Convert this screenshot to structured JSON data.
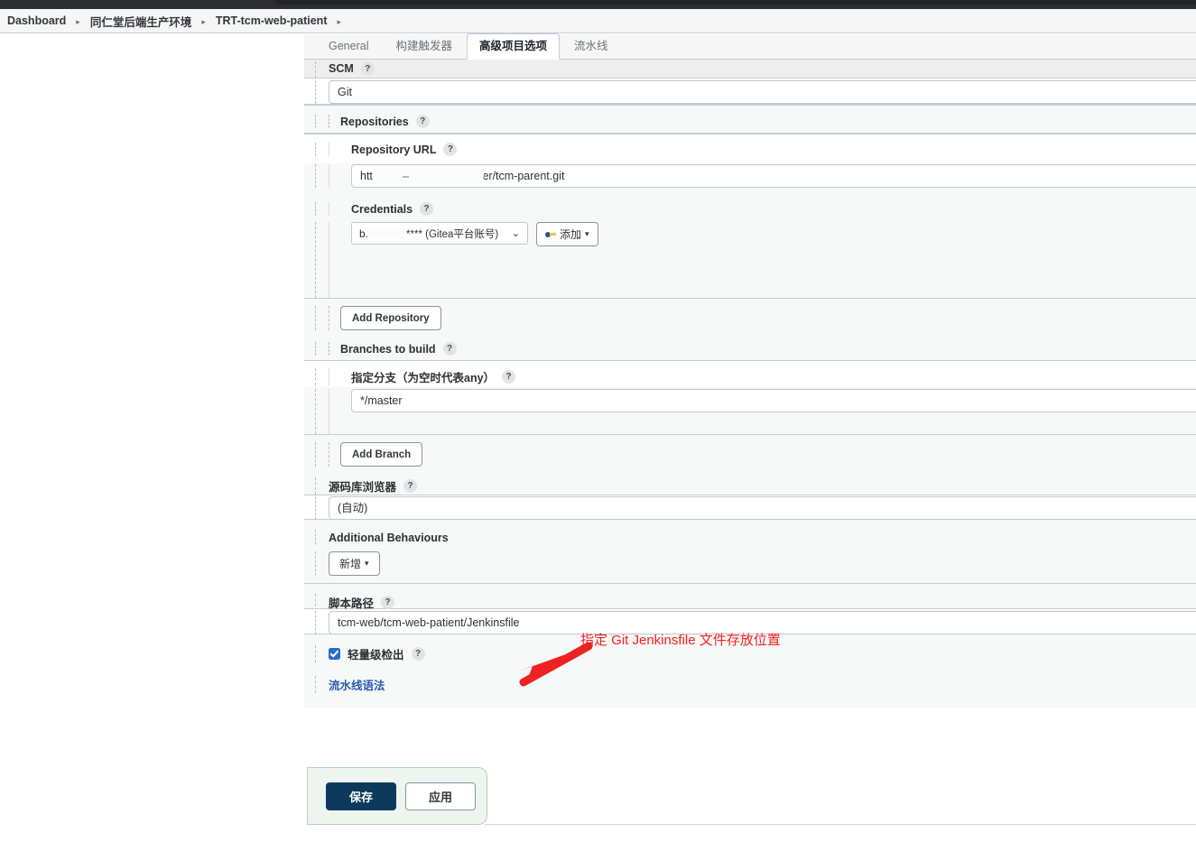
{
  "breadcrumb": {
    "items": [
      {
        "label": "Dashboard"
      },
      {
        "label": "同仁堂后端生产环境"
      },
      {
        "label": "TRT-tcm-web-patient"
      }
    ],
    "separator": "▸"
  },
  "tabs": [
    {
      "label": "General",
      "active": false
    },
    {
      "label": "构建触发器",
      "active": false
    },
    {
      "label": "高级项目选项",
      "active": true
    },
    {
      "label": "流水线",
      "active": false
    }
  ],
  "form": {
    "scm": {
      "label": "SCM",
      "help": "?",
      "value": "Git"
    },
    "repositories": {
      "label": "Repositories",
      "help": "?",
      "repository_url": {
        "label": "Repository URL",
        "help": "?",
        "value_prefix": "htt",
        "value_suffix": "/er/tcm-parent.git"
      },
      "credentials": {
        "label": "Credentials",
        "help": "?",
        "selected_prefix": "b.",
        "selected_suffix": "**** (Gitea平台账号)",
        "caret": "⌄",
        "add_button": "添加",
        "add_caret": "▾"
      },
      "add_repository_button": "Add Repository"
    },
    "branches": {
      "label": "Branches to build",
      "help": "?",
      "branch_spec": {
        "label": "指定分支（为空时代表any）",
        "help": "?",
        "value": "*/master"
      },
      "add_branch_button": "Add Branch"
    },
    "browser": {
      "label": "源码库浏览器",
      "help": "?",
      "value": "(自动)"
    },
    "additional_behaviours": {
      "label": "Additional Behaviours",
      "add_button": "新增",
      "add_caret": "▾"
    },
    "script_path": {
      "label": "脚本路径",
      "help": "?",
      "value": "tcm-web/tcm-web-patient/Jenkinsfile"
    },
    "lightweight_checkout": {
      "label": "轻量级检出",
      "help": "?",
      "checked": true
    },
    "pipeline_syntax_link": "流水线语法"
  },
  "actions": {
    "save_label": "保存",
    "apply_label": "应用"
  },
  "annotation": {
    "text": "指定 Git Jenkinsfile 文件存放位置",
    "color": "#f42121"
  },
  "colors": {
    "save_button": "#0b3a5c",
    "accent_link": "#2a5db0",
    "checkbox": "#2b6bcc",
    "save_bar_bg": "#eef4ee",
    "annotation": "#f42121"
  }
}
